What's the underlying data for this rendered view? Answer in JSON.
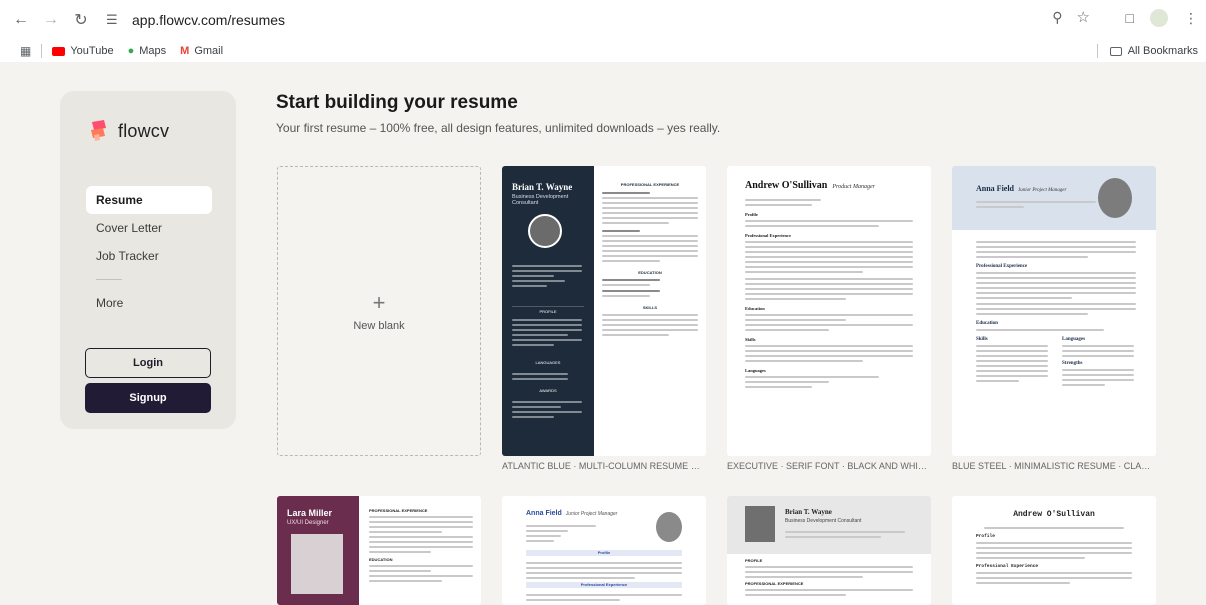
{
  "browser": {
    "url": "app.flowcv.com/resumes",
    "bookmarks": [
      {
        "label": "YouTube"
      },
      {
        "label": "Maps"
      },
      {
        "label": "Gmail"
      }
    ],
    "all_bookmarks": "All Bookmarks"
  },
  "sidebar": {
    "logo": "flowcv",
    "items": [
      {
        "label": "Resume"
      },
      {
        "label": "Cover Letter"
      },
      {
        "label": "Job Tracker"
      },
      {
        "label": "More"
      }
    ],
    "login_label": "Login",
    "signup_label": "Signup"
  },
  "main": {
    "title": "Start building your resume",
    "subtitle": "Your first resume – 100% free, all design features, unlimited downloads – yes really.",
    "new_blank_label": "New blank",
    "templates": [
      {
        "caption": "ATLANTIC BLUE · MULTI-COLUMN RESUME WITH SIDEBAR ...",
        "name": "Brian T. Wayne",
        "role": "Business Development Consultant"
      },
      {
        "caption": "EXECUTIVE · SERIF FONT · BLACK AND WHITE RESUME TE...",
        "name": "Andrew O'Sullivan",
        "role": "Product Manager"
      },
      {
        "caption": "BLUE STEEL · MINIMALISTIC RESUME · CLASSIC",
        "name": "Anna Field",
        "role": "Junior Project Manager"
      },
      {
        "caption": "",
        "name": "Lara Miller",
        "role": "UX/UI Designer"
      },
      {
        "caption": "",
        "name": "Anna Field",
        "role": "Junior Project Manager"
      },
      {
        "caption": "",
        "name": "Brian T. Wayne",
        "role": "Business Development Consultant"
      },
      {
        "caption": "",
        "name": "Andrew O'Sullivan",
        "role": ""
      }
    ],
    "section_labels": {
      "professional_experience": "PROFESSIONAL EXPERIENCE",
      "profile": "PROFILE",
      "education": "EDUCATION",
      "skills": "SKILLS",
      "languages": "LANGUAGES",
      "awards": "AWARDS",
      "profile_title": "Profile",
      "experience_title": "Professional Experience",
      "education_title": "Education",
      "skills_title": "Skills",
      "languages_title": "Languages",
      "strengths_title": "Strengths"
    }
  },
  "colors": {
    "atlantic_blue": "#1d2b3a",
    "blue_steel_header": "#d9e2ec",
    "lara_purple": "#6b2d4d",
    "signup_dark": "#221b35"
  }
}
